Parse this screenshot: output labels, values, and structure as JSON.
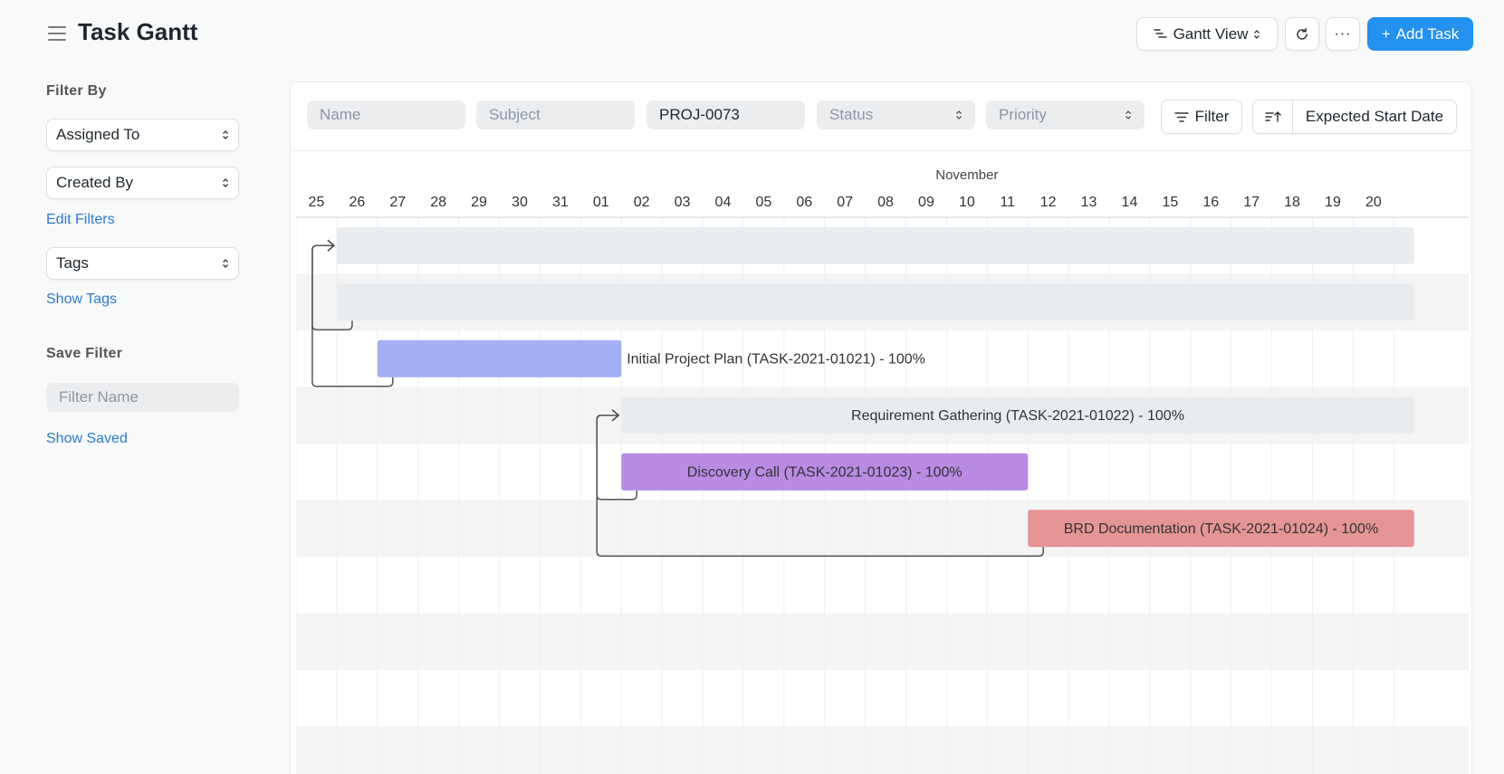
{
  "header": {
    "title": "Task Gantt",
    "view_label": "Gantt View",
    "more_label": "···",
    "add_label": "Add Task",
    "add_icon": "+"
  },
  "sidebar": {
    "filter_heading": "Filter By",
    "assigned_to": "Assigned To",
    "created_by": "Created By",
    "edit_filters": "Edit Filters",
    "tags": "Tags",
    "show_tags": "Show Tags",
    "save_heading": "Save Filter",
    "filter_name_placeholder": "Filter Name",
    "show_saved": "Show Saved"
  },
  "filters": {
    "name_placeholder": "Name",
    "subject_placeholder": "Subject",
    "project_value": "PROJ-0073",
    "status_placeholder": "Status",
    "priority_placeholder": "Priority",
    "filter_label": "Filter",
    "sort_label": "Expected Start Date"
  },
  "gantt": {
    "month_label": "November",
    "days": [
      "25",
      "26",
      "27",
      "28",
      "29",
      "30",
      "31",
      "01",
      "02",
      "03",
      "04",
      "05",
      "06",
      "07",
      "08",
      "09",
      "10",
      "11",
      "12",
      "13",
      "14",
      "15",
      "16",
      "17",
      "18",
      "19",
      "20"
    ],
    "tasks": [
      {
        "label": "",
        "start": 1,
        "end": 27.5,
        "color": "#e9ecef",
        "progress_color": "#e9ecef",
        "label_pos": "inside"
      },
      {
        "label": "",
        "start": 1,
        "end": 27.5,
        "color": "#e9ecef",
        "progress_color": "#e9ecef",
        "label_pos": "inside"
      },
      {
        "label": "Initial Project Plan (TASK-2021-01021) - 100%",
        "start": 2,
        "end": 8,
        "color": "#a3b0f5",
        "label_pos": "outside"
      },
      {
        "label": "Requirement Gathering (TASK-2021-01022) - 100%",
        "start": 8,
        "end": 27.5,
        "color": "#e9ecef",
        "label_pos": "inside"
      },
      {
        "label": "Discovery Call (TASK-2021-01023) - 100%",
        "start": 8,
        "end": 18,
        "color": "#b98be3",
        "label_pos": "inside"
      },
      {
        "label": "BRD Documentation (TASK-2021-01024) - 100%",
        "start": 18,
        "end": 27.5,
        "color": "#e59595",
        "label_pos": "inside"
      }
    ],
    "empty_rows": 4,
    "dependencies": [
      {
        "from": 1,
        "to": 0
      },
      {
        "from": 2,
        "to": 0
      },
      {
        "from": 4,
        "to": 3
      },
      {
        "from": 5,
        "to": 3
      }
    ]
  }
}
